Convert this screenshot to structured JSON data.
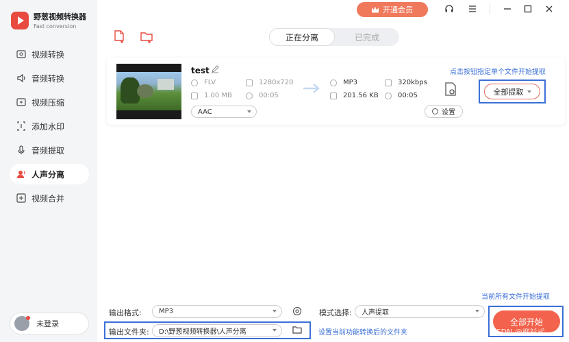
{
  "app": {
    "name": "野葱视频转换器",
    "subtitle": "Fast conversion",
    "brand_color": "#e84a3f"
  },
  "sidebar": {
    "items": [
      {
        "label": "视频转换",
        "icon": "video-convert-icon"
      },
      {
        "label": "音频转换",
        "icon": "audio-convert-icon"
      },
      {
        "label": "视频压缩",
        "icon": "video-compress-icon"
      },
      {
        "label": "添加水印",
        "icon": "watermark-icon"
      },
      {
        "label": "音频提取",
        "icon": "audio-extract-icon"
      },
      {
        "label": "人声分离",
        "icon": "voice-separate-icon",
        "active": true
      },
      {
        "label": "视频合并",
        "icon": "video-merge-icon"
      }
    ],
    "login_label": "未登录"
  },
  "topbar": {
    "vip_label": "开通会员",
    "vip_color": "#f0795c"
  },
  "tabs": [
    {
      "label": "正在分离",
      "active": true
    },
    {
      "label": "已完成",
      "active": false
    }
  ],
  "file": {
    "name": "test",
    "source": {
      "format": "FLV",
      "resolution": "1280x720",
      "size": "1.00 MB",
      "duration": "00:05"
    },
    "target": {
      "format": "MP3",
      "bitrate": "320kbps",
      "size": "201.56 KB",
      "duration": "00:05"
    },
    "audio_track": "AAC",
    "settings_label": "设置",
    "hint": "点击按钮指定单个文件开始提取",
    "extract_label": "全部提取"
  },
  "bottom": {
    "hint_all": "当前所有文件开始提取",
    "format_label": "输出格式:",
    "format_value": "MP3",
    "mode_label": "模式选择:",
    "mode_value": "人声提取",
    "folder_label": "输出文件夹:",
    "folder_value": "D:\\野葱视频转换器\\人声分离",
    "folder_link": "设置当前功能转换后的文件夹",
    "start_label": "全部开始",
    "accent_color": "#f2624c"
  },
  "watermark": "CSDN @柳衫式"
}
